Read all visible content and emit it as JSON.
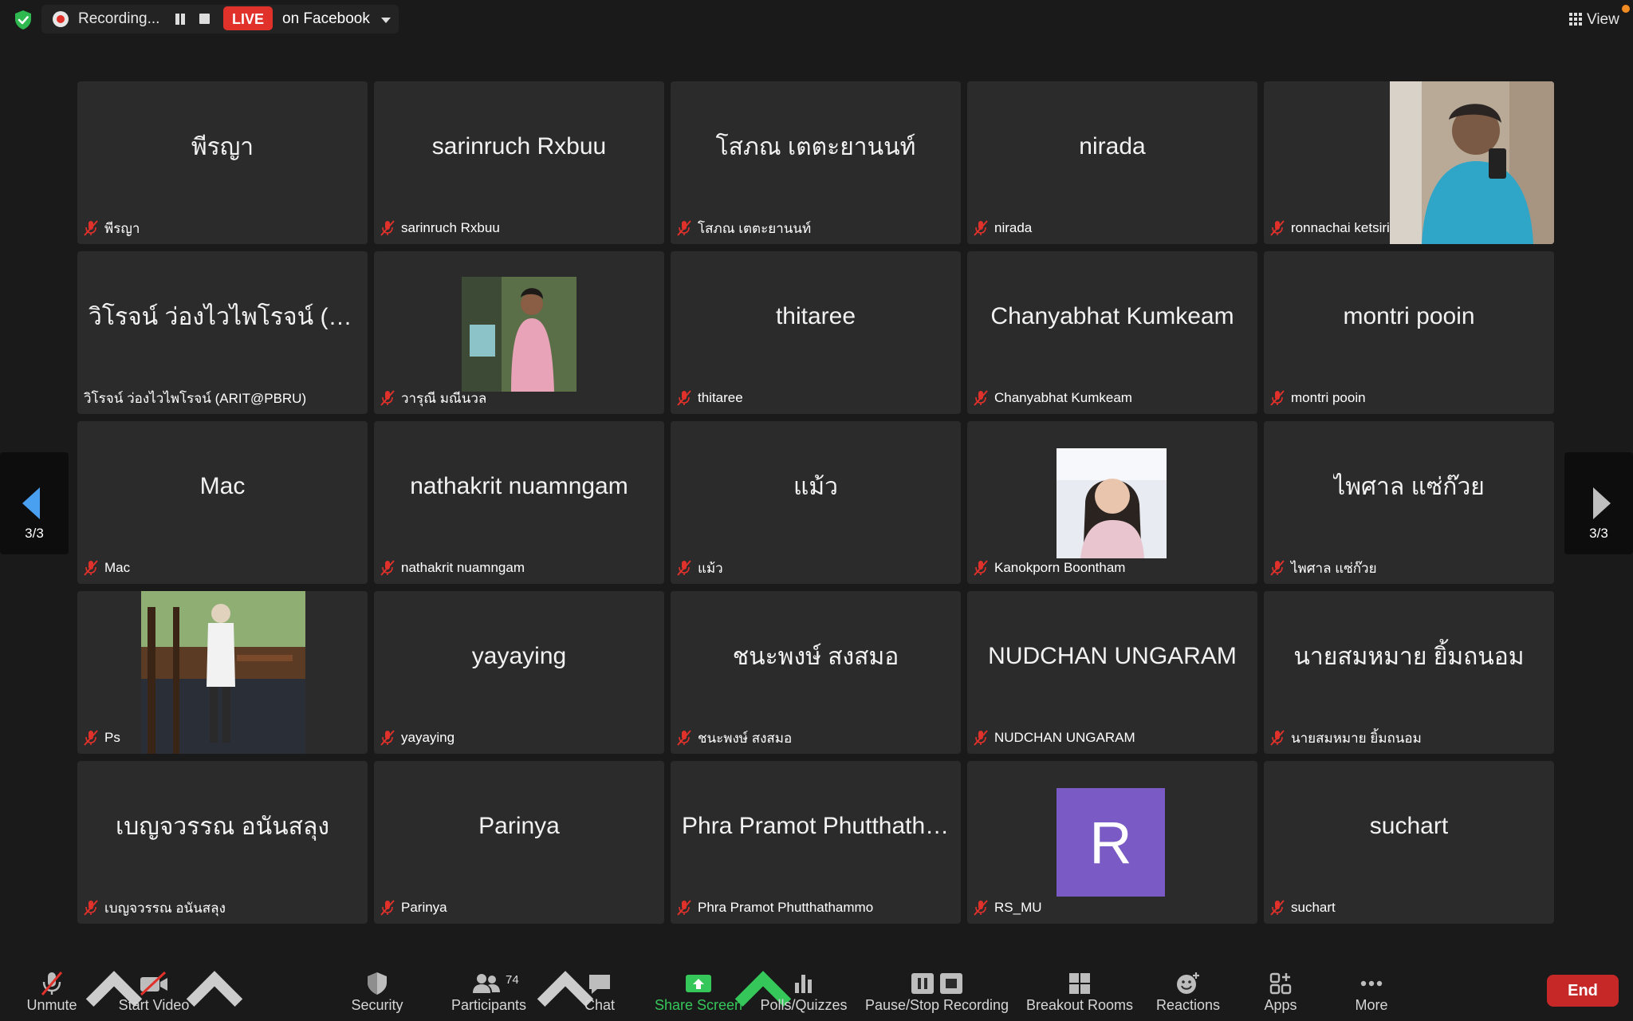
{
  "topbar": {
    "recording_label": "Recording...",
    "live_badge": "LIVE",
    "live_destination": "on Facebook",
    "view_label": "View"
  },
  "tiles": [
    {
      "center": "พีรญา",
      "label": "พีรญา",
      "muted": true
    },
    {
      "center": "sarinruch Rxbuu",
      "label": "sarinruch Rxbuu",
      "muted": true
    },
    {
      "center": "โสภณ เตตะยานนท์",
      "label": "โสภณ เตตะยานนท์",
      "muted": true
    },
    {
      "center": "nirada",
      "label": "nirada",
      "muted": true
    },
    {
      "center": "",
      "label": "ronnachai ketsiri",
      "muted": true,
      "video": "photo-person-blue-shirt"
    },
    {
      "center": "วิโรจน์ ว่องไวไพโรจน์  (AR...",
      "label": "วิโรจน์ ว่องไวไพโรจน์  (ARIT@PBRU)",
      "muted": false
    },
    {
      "center": "",
      "label": "วารุณี มณีนวล",
      "muted": true,
      "video": "photo-woman-pink-dress"
    },
    {
      "center": "thitaree",
      "label": "thitaree",
      "muted": true
    },
    {
      "center": "Chanyabhat Kumkeam",
      "label": "Chanyabhat Kumkeam",
      "muted": true
    },
    {
      "center": "montri pooin",
      "label": "montri pooin",
      "muted": true
    },
    {
      "center": "Mac",
      "label": "Mac",
      "muted": true
    },
    {
      "center": "nathakrit nuamngam",
      "label": "nathakrit nuamngam",
      "muted": true
    },
    {
      "center": "แม้ว",
      "label": "แม้ว",
      "muted": true
    },
    {
      "center": "",
      "label": "Kanokporn Boontham",
      "muted": true,
      "video": "photo-woman-portrait"
    },
    {
      "center": "ไพศาล แซ่ก๊วย",
      "label": "ไพศาล แซ่ก๊วย",
      "muted": true
    },
    {
      "center": "",
      "label": "Ps",
      "muted": true,
      "video": "photo-person-restaurant"
    },
    {
      "center": "yayaying",
      "label": "yayaying",
      "muted": true
    },
    {
      "center": "ชนะพงษ์  สงสมอ",
      "label": "ชนะพงษ์  สงสมอ",
      "muted": true
    },
    {
      "center": "NUDCHAN UNGARAM",
      "label": "NUDCHAN UNGARAM",
      "muted": true
    },
    {
      "center": "นายสมหมาย ยิ้มถนอม",
      "label": "นายสมหมาย ยิ้มถนอม",
      "muted": true
    },
    {
      "center": "เบญจวรรณ อนันสลุง",
      "label": "เบญจวรรณ อนันสลุง",
      "muted": true
    },
    {
      "center": "Parinya",
      "label": "Parinya",
      "muted": true
    },
    {
      "center": "Phra Pramot Phutthatha...",
      "label": "Phra Pramot Phutthathammo",
      "muted": true
    },
    {
      "center": "",
      "label": "RS_MU",
      "muted": true,
      "avatar_letter": "R"
    },
    {
      "center": "suchart",
      "label": "suchart",
      "muted": true
    }
  ],
  "nav": {
    "left_page": "3/3",
    "right_page": "3/3"
  },
  "toolbar": {
    "unmute": "Unmute",
    "start_video": "Start Video",
    "security": "Security",
    "participants": "Participants",
    "participant_count": "74",
    "chat": "Chat",
    "share_screen": "Share Screen",
    "polls": "Polls/Quizzes",
    "pause_stop_recording": "Pause/Stop Recording",
    "breakout_rooms": "Breakout Rooms",
    "reactions": "Reactions",
    "apps": "Apps",
    "more": "More",
    "end": "End"
  },
  "colors": {
    "background": "#1a1a1a",
    "tile": "#2b2b2b",
    "live_red": "#e0312b",
    "share_green": "#35c75a",
    "end_red": "#c62828",
    "mute_red": "#e0312b",
    "avatar_purple": "#7a5ac4",
    "nav_arrow_blue": "#4aa0f0"
  }
}
